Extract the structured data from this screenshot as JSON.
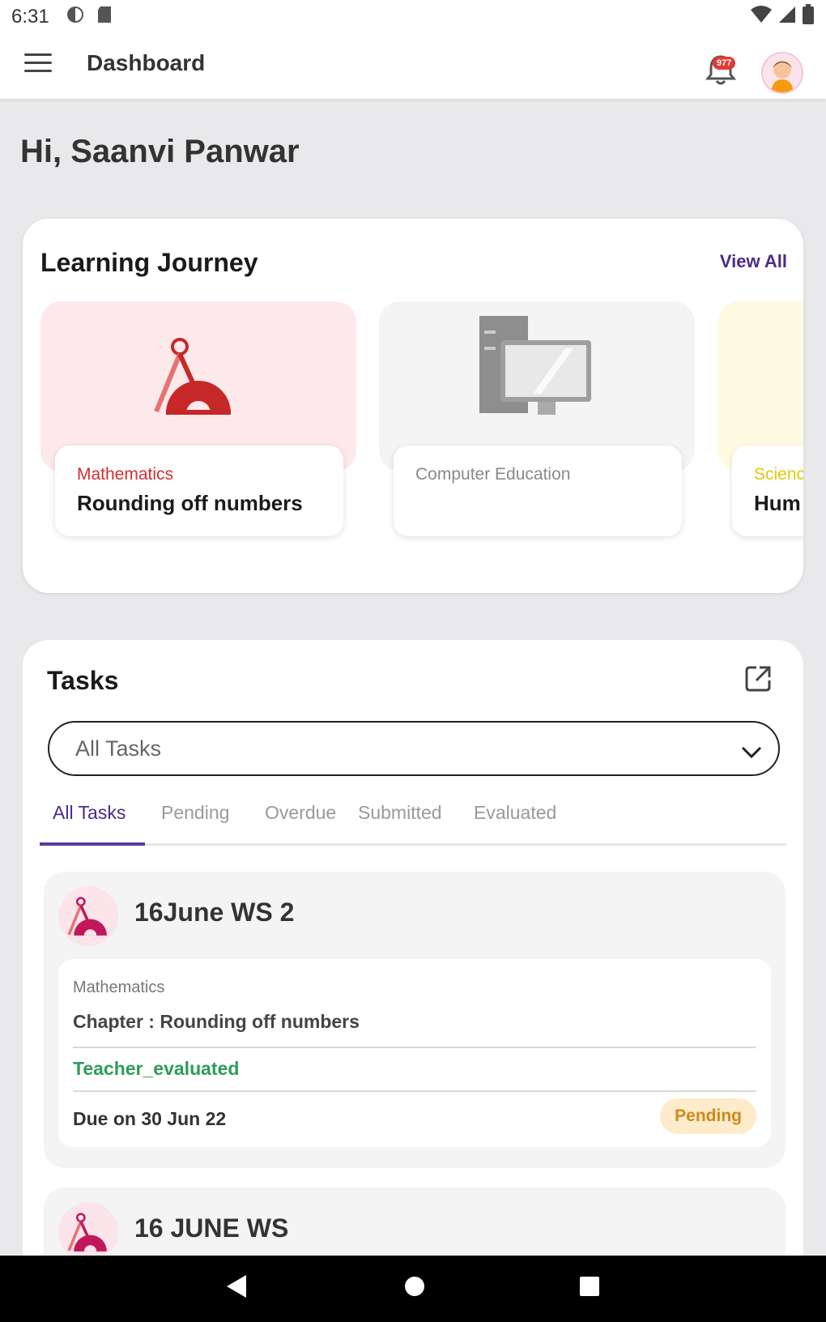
{
  "status_bar": {
    "time": "6:31"
  },
  "app_bar": {
    "title": "Dashboard",
    "notification_count": "977"
  },
  "greeting": "Hi, Saanvi Panwar",
  "learning_journey": {
    "title": "Learning Journey",
    "view_all": "View All",
    "subjects": [
      {
        "subject": "Mathematics",
        "topic": "Rounding off numbers",
        "subject_color": "#d32f2f",
        "bg": "#fde8ea",
        "icon": "compass-protractor-icon"
      },
      {
        "subject": "Computer Education",
        "topic": "",
        "subject_color": "#8a8a8a",
        "bg": "#f4f4f5",
        "icon": "computer-icon"
      },
      {
        "subject": "Scienc",
        "topic": "Hum",
        "subject_color": "#e0c80a",
        "bg": "#fffbe3",
        "icon": "science-icon"
      }
    ]
  },
  "tasks": {
    "title": "Tasks",
    "filter_value": "All Tasks",
    "tabs": [
      "All Tasks",
      "Pending",
      "Overdue",
      "Submitted",
      "Evaluated"
    ],
    "active_tab": "All Tasks",
    "items": [
      {
        "name": "16June WS 2",
        "subject": "Mathematics",
        "chapter": "Chapter : Rounding off numbers",
        "evaluation": "Teacher_evaluated",
        "due": "Due on 30 Jun 22",
        "status": "Pending"
      },
      {
        "name": "16 JUNE WS"
      }
    ]
  },
  "colors": {
    "accent": "#4b2a8c",
    "pending_bg": "#fdebcc",
    "pending_text": "#d08a1a",
    "evaluated_text": "#2e9c5a"
  }
}
